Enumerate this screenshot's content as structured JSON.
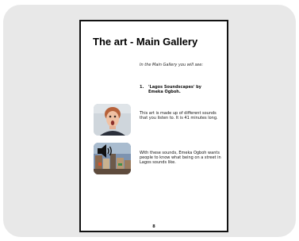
{
  "document": {
    "title": "The art - Main Gallery",
    "intro": "In the Main Gallery you will see:",
    "item": {
      "number": "1.",
      "text": "'Lagos Soundscapes' by Emeka Ogboh."
    },
    "paragraph_1": "This art is made up of different sounds that you listen to. It is 41 minutes long.",
    "paragraph_2": "With these sounds, Emeka Ogboh wants people to know what being on a street in Lagos sounds like.",
    "page_number": "8"
  },
  "images": {
    "thumb_1": "person-surprised-face",
    "thumb_2": "speaker-icon-over-city-street"
  }
}
